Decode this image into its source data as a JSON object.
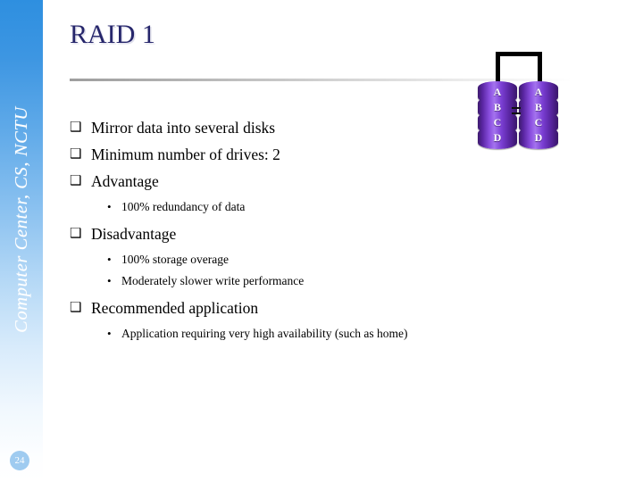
{
  "sidebar": {
    "vertical_label": "Computer Center, CS, NCTU",
    "page_number": "24"
  },
  "slide": {
    "title": "RAID 1",
    "bullets": [
      {
        "level": 1,
        "marker": "❑",
        "text": "Mirror data into several disks"
      },
      {
        "level": 1,
        "marker": "❑",
        "text": "Minimum number of drives: 2"
      },
      {
        "level": 1,
        "marker": "❑",
        "text": "Advantage"
      },
      {
        "level": 2,
        "marker": "•",
        "text": "100% redundancy of data"
      },
      {
        "level": 1,
        "marker": "❑",
        "text": "Disadvantage"
      },
      {
        "level": 2,
        "marker": "•",
        "text": "100% storage overage"
      },
      {
        "level": 2,
        "marker": "•",
        "text": "Moderately slower write performance"
      },
      {
        "level": 1,
        "marker": "❑",
        "text": "Recommended application"
      },
      {
        "level": 2,
        "marker": "•",
        "text": "Application requiring very high availability (such as home)"
      }
    ]
  },
  "diagram": {
    "name": "raid-1-mirroring-diagram",
    "connector": "=",
    "disks": [
      {
        "id": "disk-left",
        "blocks": [
          "A",
          "B",
          "C",
          "D"
        ]
      },
      {
        "id": "disk-right",
        "blocks": [
          "A",
          "B",
          "C",
          "D"
        ]
      }
    ]
  },
  "colors": {
    "title": "#26266B",
    "sidebar_top": "#2E8FE0",
    "sidebar_bottom": "#FFFFFF",
    "badge": "#9FCBF0",
    "disk_purple": "#6A2EBF",
    "bracket": "#000000"
  },
  "b0_marker": "❑",
  "b0_text": "Mirror data into several disks",
  "b1_marker": "❑",
  "b1_text": "Minimum number of drives: 2",
  "b2_marker": "❑",
  "b2_text": "Advantage",
  "b3_marker": "•",
  "b3_text": "100% redundancy of data",
  "b4_marker": "❑",
  "b4_text": "Disadvantage",
  "b5_marker": "•",
  "b5_text": "100% storage overage",
  "b6_marker": "•",
  "b6_text": "Moderately slower write performance",
  "b7_marker": "❑",
  "b7_text": "Recommended application",
  "b8_marker": "•",
  "b8_text": "Application requiring very high availability (such as home)"
}
